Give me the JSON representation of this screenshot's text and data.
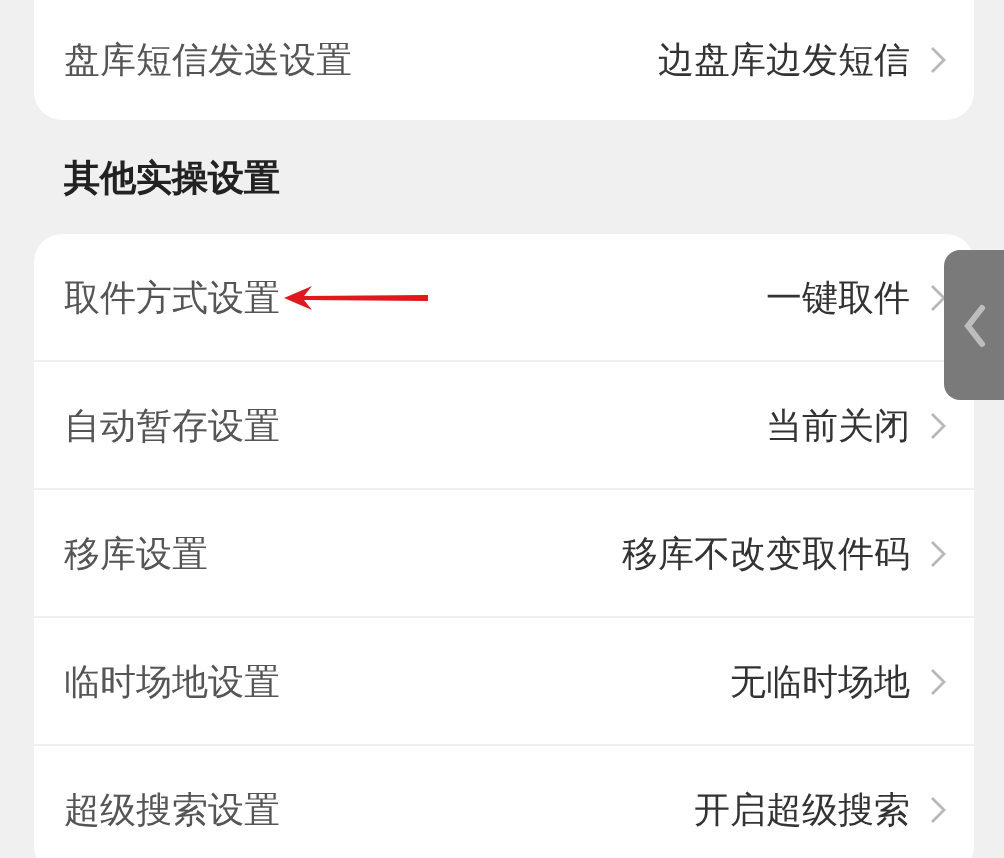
{
  "groups": [
    {
      "rows": [
        {
          "label": "盘库短信发送设置",
          "value": "边盘库边发短信",
          "arrow_pointer": false
        }
      ]
    },
    {
      "title": "其他实操设置",
      "rows": [
        {
          "label": "取件方式设置",
          "value": "一键取件",
          "arrow_pointer": true
        },
        {
          "label": "自动暂存设置",
          "value": "当前关闭",
          "arrow_pointer": false
        },
        {
          "label": "移库设置",
          "value": "移库不改变取件码",
          "arrow_pointer": false
        },
        {
          "label": "临时场地设置",
          "value": "无临时场地",
          "arrow_pointer": false
        },
        {
          "label": "超级搜索设置",
          "value": "开启超级搜索",
          "arrow_pointer": false
        }
      ]
    }
  ]
}
